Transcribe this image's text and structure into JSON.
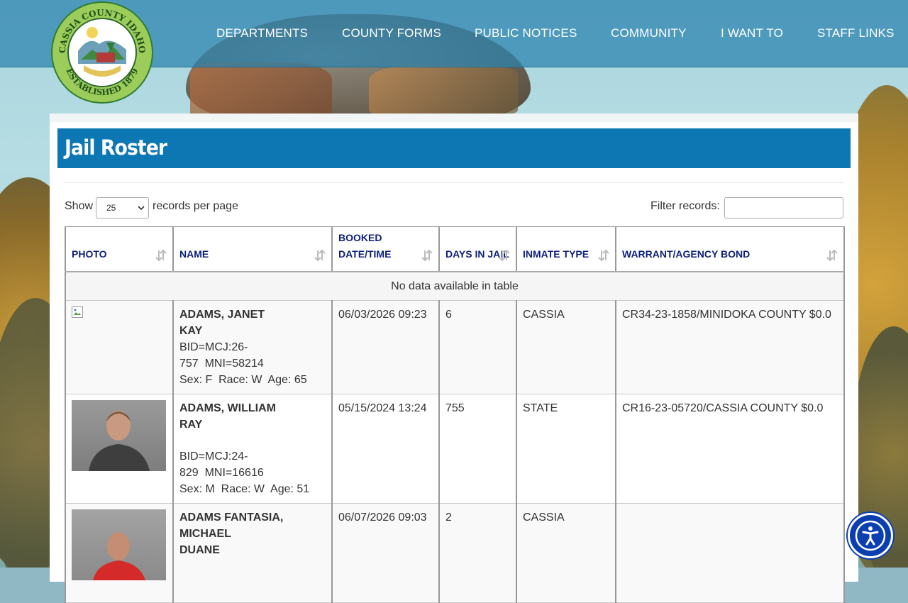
{
  "header": {
    "logo": {
      "text_top": "CASSIA COUNTY IDAHO",
      "text_bottom": "ESTABLISHED 1879"
    },
    "nav": [
      {
        "label": "DEPARTMENTS"
      },
      {
        "label": "COUNTY FORMS"
      },
      {
        "label": "PUBLIC NOTICES"
      },
      {
        "label": "COMMUNITY"
      },
      {
        "label": "I WANT TO"
      },
      {
        "label": "STAFF LINKS"
      }
    ]
  },
  "page": {
    "title": "Jail Roster"
  },
  "controls": {
    "show_label": "Show",
    "per_page_value": "25",
    "records_per_page_label": "records per page",
    "filter_label": "Filter records:",
    "filter_value": ""
  },
  "table": {
    "columns": [
      {
        "label": "PHOTO"
      },
      {
        "label": "NAME"
      },
      {
        "label": "BOOKED DATE/TIME"
      },
      {
        "label": "DAYS IN JAIL"
      },
      {
        "label": "INMATE TYPE"
      },
      {
        "label": "WARRANT/AGENCY BOND"
      }
    ],
    "empty_message": "No data available in table",
    "rows": [
      {
        "name_first_line": "ADAMS, JANET",
        "name_second_line": "KAY",
        "bid_line1": "BID=MCJ:26-",
        "bid_line2": "757  MNI=58214",
        "demographics": "Sex: F  Race: W  Age: 65",
        "booked": "06/03/2026 09:23",
        "days": "6",
        "inmate_type": "CASSIA",
        "warrant": "CR34-23-1858/MINIDOKA COUNTY $0.0"
      },
      {
        "name_first_line": "ADAMS, WILLIAM",
        "name_second_line": "RAY",
        "bid_line1": "BID=MCJ:24-",
        "bid_line2": "829  MNI=16616",
        "demographics": "Sex: M  Race: W  Age: 51",
        "booked": "05/15/2024 13:24",
        "days": "755",
        "inmate_type": "STATE",
        "warrant": "CR16-23-05720/CASSIA COUNTY $0.0"
      },
      {
        "name_first_line": "ADAMS FANTASIA,",
        "name_second_line": "MICHAEL",
        "name_third_line": "DUANE",
        "booked": "06/07/2026 09:03",
        "days": "2",
        "inmate_type": "CASSIA",
        "warrant": ""
      }
    ]
  },
  "colors": {
    "header_bg": "#2a82af",
    "title_bar": "#0c77b3",
    "column_header_text": "#0c1f7a",
    "a11y_button": "#0b3fb0"
  },
  "icons": {
    "sort": "sort-arrows-icon",
    "a11y": "accessibility-icon",
    "select": "chevron-down-icon"
  }
}
